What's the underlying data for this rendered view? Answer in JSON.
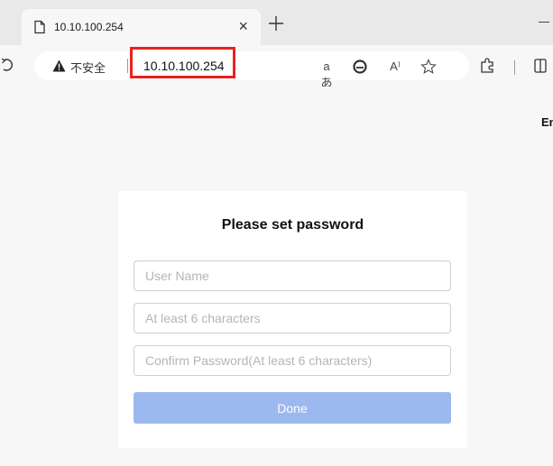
{
  "browser": {
    "tab": {
      "title": "10.10.100.254"
    },
    "address_bar": {
      "security_label": "不安全",
      "url": "10.10.100.254"
    },
    "toolbar_icons": {
      "translate": "aあ",
      "read_aloud": "A⁾"
    }
  },
  "page": {
    "language_link": "En",
    "form": {
      "title": "Please set password",
      "username_placeholder": "User Name",
      "password_placeholder": "At least 6 characters",
      "confirm_placeholder": "Confirm Password(At least 6 characters)",
      "submit_label": "Done"
    }
  },
  "colors": {
    "button_disabled": "#9bb8ef",
    "highlight_box": "#e8231e",
    "page_background": "#f7f7f7"
  }
}
